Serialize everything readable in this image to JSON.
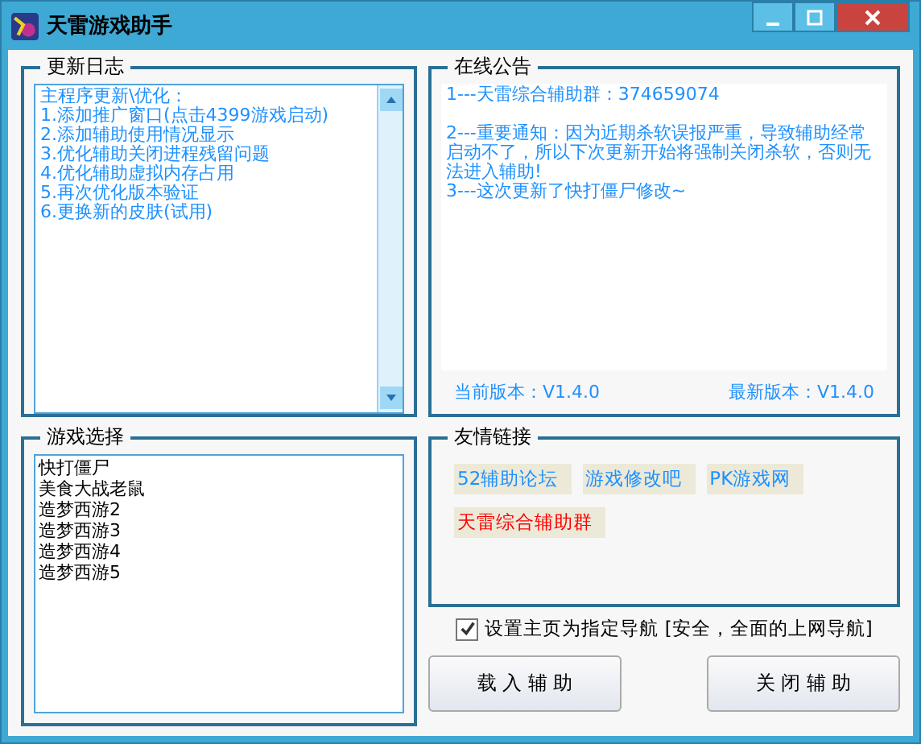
{
  "window": {
    "title": "天雷游戏助手"
  },
  "update_log": {
    "title": "更新日志",
    "lines": [
      "主程序更新\\优化：",
      "1.添加推广窗口(点击4399游戏启动)",
      "2.添加辅助使用情况显示",
      "3.优化辅助关闭进程残留问题",
      "4.优化辅助虚拟内存占用",
      "5.再次优化版本验证",
      "6.更换新的皮肤(试用)"
    ]
  },
  "announcement": {
    "title": "在线公告",
    "lines": [
      "1---天雷综合辅助群：374659074",
      "2---重要通知：因为近期杀软误报严重，导致辅助经常启动不了，所以下次更新开始将强制关闭杀软，否则无法进入辅助!",
      "3---这次更新了快打僵尸修改~"
    ],
    "current_version": "当前版本：V1.4.0",
    "latest_version": "最新版本：V1.4.0"
  },
  "game_select": {
    "title": "游戏选择",
    "games": [
      "快打僵尸",
      "美食大战老鼠",
      "造梦西游2",
      "造梦西游3",
      "造梦西游4",
      "造梦西游5"
    ]
  },
  "links": {
    "title": "友情链接",
    "items": [
      {
        "label": "52辅助论坛",
        "color": "#1e90ff"
      },
      {
        "label": "游戏修改吧",
        "color": "#1e90ff"
      },
      {
        "label": "PK游戏网",
        "color": "#1e90ff"
      },
      {
        "label": "天雷综合辅助群",
        "color": "#ff0000"
      }
    ]
  },
  "homepage_option": {
    "label": "设置主页为指定导航 [安全，全面的上网导航]",
    "checked": true
  },
  "buttons": [
    "载 入 辅 助",
    "关 闭 辅 助"
  ]
}
